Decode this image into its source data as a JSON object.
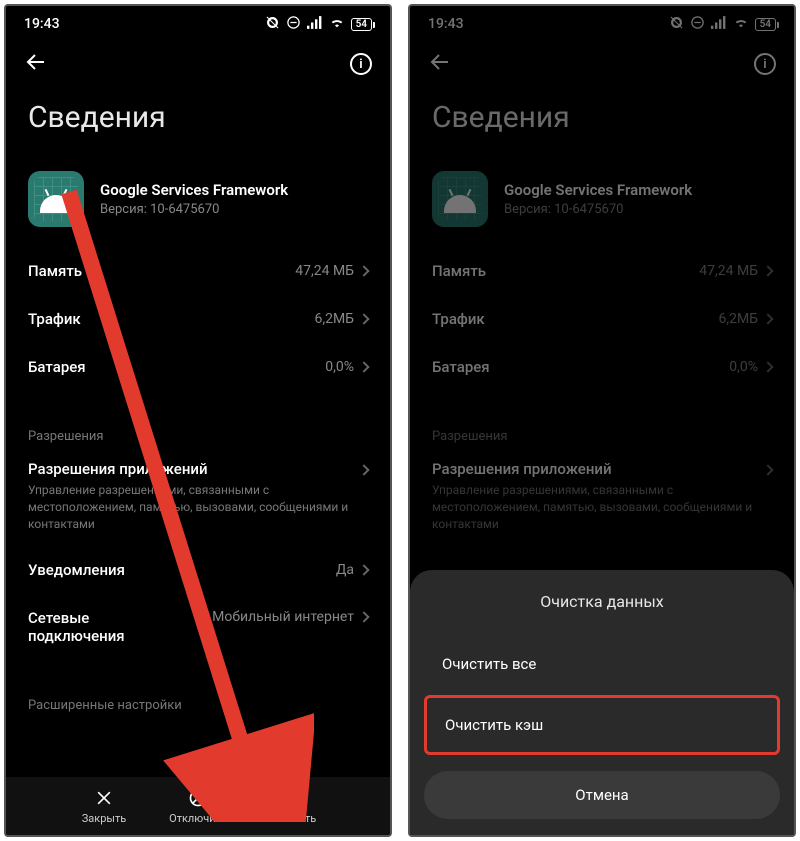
{
  "status": {
    "time": "19:43",
    "battery_text": "54"
  },
  "page": {
    "title": "Сведения"
  },
  "app": {
    "name": "Google Services Framework",
    "version": "Версия: 10-6475670"
  },
  "items": {
    "memory": {
      "label": "Память",
      "value": "47,24 МБ"
    },
    "traffic": {
      "label": "Трафик",
      "value": "6,2МБ"
    },
    "battery": {
      "label": "Батарея",
      "value": "0,0%"
    }
  },
  "permissions_section": "Разрешения",
  "app_permissions": {
    "label": "Разрешения приложений",
    "subtitle": "Управление разрешениями, связанными с местоположением, памятью, вызовами, сообщениями и контактами"
  },
  "notifications": {
    "label": "Уведомления",
    "value": "Да"
  },
  "network_conn": {
    "label": "Сетевые подключения",
    "value": "Мобильный интернет"
  },
  "advanced_section": "Расширенные настройки",
  "bottom_actions": {
    "close": "Закрыть",
    "disable": "Отключить",
    "clear": "Очистить"
  },
  "dialog": {
    "title": "Очистка данных",
    "clear_all": "Очистить все",
    "clear_cache": "Очистить кэш",
    "cancel": "Отмена"
  }
}
